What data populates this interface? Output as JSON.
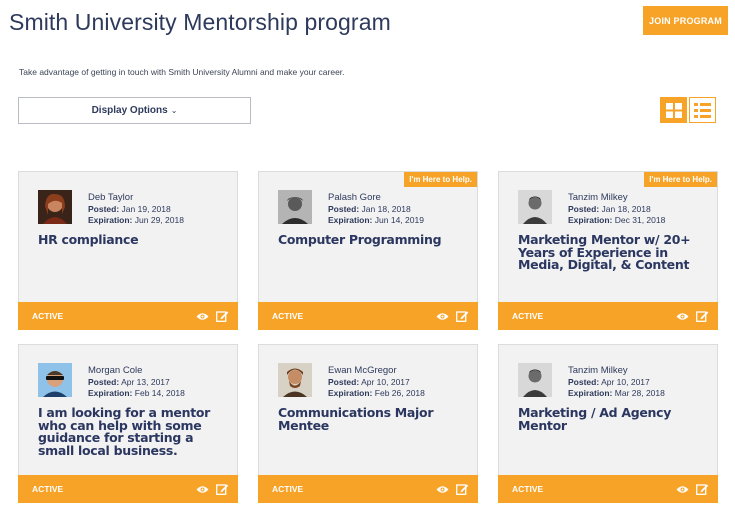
{
  "header": {
    "title": "Smith University Mentorship program",
    "join_label": "JOIN PROGRAM",
    "intro": "Take advantage of getting in touch with Smith University Alumni and make your career."
  },
  "controls": {
    "display_options_label": "Display Options",
    "active_view": "grid"
  },
  "colors": {
    "accent": "#f6a328",
    "title": "#2e3a5c",
    "card_bg": "#f2f2f2"
  },
  "labels": {
    "posted": "Posted:",
    "expiration": "Expiration:",
    "badge": "I'm Here to Help."
  },
  "cards": [
    {
      "name": "Deb Taylor",
      "posted": "Jan 19, 2018",
      "expiration": "Jun 29, 2018",
      "topic": "HR compliance",
      "status": "ACTIVE",
      "badge": false
    },
    {
      "name": "Palash Gore",
      "posted": "Jan 18, 2018",
      "expiration": "Jun 14, 2019",
      "topic": "Computer Programming",
      "status": "ACTIVE",
      "badge": true
    },
    {
      "name": "Tanzim Milkey",
      "posted": "Jan 18, 2018",
      "expiration": "Dec 31, 2018",
      "topic": "Marketing Mentor w/ 20+ Years of Experience in Media, Digital, & Content",
      "status": "ACTIVE",
      "badge": true
    },
    {
      "name": "Morgan Cole",
      "posted": "Apr 13, 2017",
      "expiration": "Feb 14, 2018",
      "topic": "I am looking for a mentor who can help with some guidance for starting a small local business.",
      "status": "ACTIVE",
      "badge": false
    },
    {
      "name": "Ewan McGregor",
      "posted": "Apr 10, 2017",
      "expiration": "Feb 26, 2018",
      "topic": "Communications Major Mentee",
      "status": "ACTIVE",
      "badge": false
    },
    {
      "name": "Tanzim Milkey",
      "posted": "Apr 10, 2017",
      "expiration": "Mar 28, 2018",
      "topic": "Marketing / Ad Agency Mentor",
      "status": "ACTIVE",
      "badge": false
    }
  ]
}
